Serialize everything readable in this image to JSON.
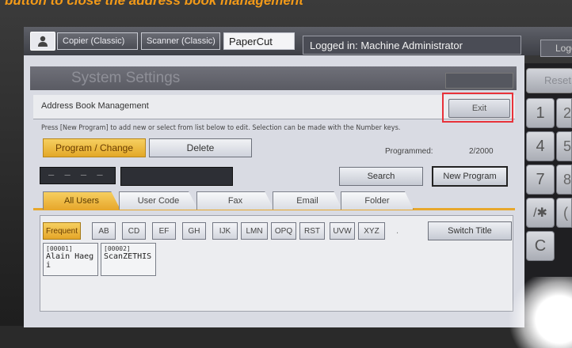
{
  "caption": "button to close the address book management",
  "topbar": {
    "apps": [
      {
        "label": "Copier (Classic)"
      },
      {
        "label": "Scanner (Classic)"
      },
      {
        "label": "PaperCut"
      }
    ],
    "login_status": "Logged in: Machine Administrator",
    "logout_label": "Logo"
  },
  "system": {
    "title": "System Settings"
  },
  "abm": {
    "title": "Address Book Management",
    "exit_label": "Exit",
    "instructions": "Press [New Program] to add new or select from list below to edit. Selection can be made with the Number keys.",
    "program_change_label": "Program / Change",
    "delete_label": "Delete",
    "programmed_label": "Programmed:",
    "programmed_count": "2/2000",
    "number_placeholder": "_ _ _ _ _",
    "search_label": "Search",
    "new_program_label": "New Program"
  },
  "tabs": [
    {
      "label": "All Users"
    },
    {
      "label": "User Code"
    },
    {
      "label": "Fax"
    },
    {
      "label": "Email"
    },
    {
      "label": "Folder"
    }
  ],
  "letters": [
    {
      "label": "Frequent"
    },
    {
      "label": "AB"
    },
    {
      "label": "CD"
    },
    {
      "label": "EF"
    },
    {
      "label": "GH"
    },
    {
      "label": "IJK"
    },
    {
      "label": "LMN"
    },
    {
      "label": "OPQ"
    },
    {
      "label": "RST"
    },
    {
      "label": "UVW"
    },
    {
      "label": "XYZ"
    }
  ],
  "dot": ".",
  "switch_title_label": "Switch Title",
  "entries": [
    {
      "number": "[00001]",
      "name": "Alain Haeg",
      "extra": "i"
    },
    {
      "number": "[00002]",
      "name": "ScanZETHIS"
    }
  ],
  "keypad": {
    "reset_label": "Reset",
    "keys": [
      "1",
      "4",
      "7",
      "/✱",
      "C"
    ],
    "partial_keys": [
      "2",
      "5",
      "8",
      "(",
      ""
    ]
  },
  "colors": {
    "accent": "#e7a72c",
    "highlight": "#e8323a",
    "caption": "#f39a18"
  }
}
